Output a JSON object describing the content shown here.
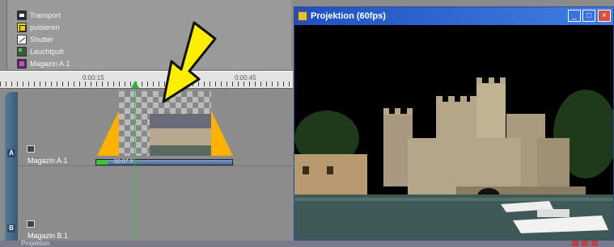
{
  "effect_list": {
    "items": [
      {
        "label": "Transport",
        "icon": "transport-icon"
      },
      {
        "label": "pulsieren",
        "icon": "pulse-icon"
      },
      {
        "label": "Shutter",
        "icon": "shutter-icon"
      },
      {
        "label": "Leuchtpult",
        "icon": "lightbox-icon"
      },
      {
        "label": "Magazin A.1",
        "icon": "magazin-icon"
      }
    ]
  },
  "ruler": {
    "label_left": "0:00:15",
    "label_right": "0:00:45"
  },
  "tracks": [
    {
      "letter": "A",
      "label": "Magazin A.1"
    },
    {
      "letter": "B",
      "label": "Magazin B.1"
    }
  ],
  "clip": {
    "duration": "00:07.3"
  },
  "projection": {
    "title": "Projektion (60fps)",
    "minimize": "_",
    "maximize": "□",
    "close": "×"
  },
  "status": {
    "text": "Projektion"
  },
  "colors": {
    "fade": "#ffb000",
    "arrow": "#ffee00",
    "titlebar": "#2050c0",
    "playhead": "#30c050"
  }
}
